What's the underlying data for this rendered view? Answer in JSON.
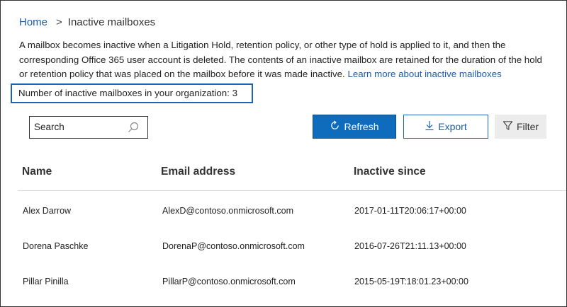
{
  "breadcrumb": {
    "home": "Home",
    "separator": ">",
    "current": "Inactive mailboxes"
  },
  "description": {
    "text": "A mailbox becomes inactive when a Litigation Hold, retention policy, or other type of hold is applied to it, and then the corresponding Office 365 user account is deleted. The contents of an inactive mailbox are retained for the duration of the hold or retention policy that was placed on the mailbox before it was made inactive.",
    "link": "Learn more about inactive mailboxes"
  },
  "count": {
    "label": "Number of inactive mailboxes in your organization:",
    "value": "3"
  },
  "search": {
    "placeholder": "Search"
  },
  "toolbar": {
    "refresh_label": "Refresh",
    "export_label": "Export",
    "filter_label": "Filter",
    "accent": "#0f6cbd"
  },
  "table": {
    "headers": {
      "name": "Name",
      "email": "Email address",
      "since": "Inactive since"
    },
    "rows": [
      {
        "name": "Alex Darrow",
        "email": "AlexD@contoso.onmicrosoft.com",
        "since": "2017-01-11T20:06:17+00:00"
      },
      {
        "name": "Dorena Paschke",
        "email": "DorenaP@contoso.onmicrosoft.com",
        "since": "2016-07-26T21:11.13+00:00"
      },
      {
        "name": "Pillar Pinilla",
        "email": "PillarP@contoso.onmicrosoft.com",
        "since": "2015-05-19T:18:01.23+00:00"
      }
    ]
  }
}
